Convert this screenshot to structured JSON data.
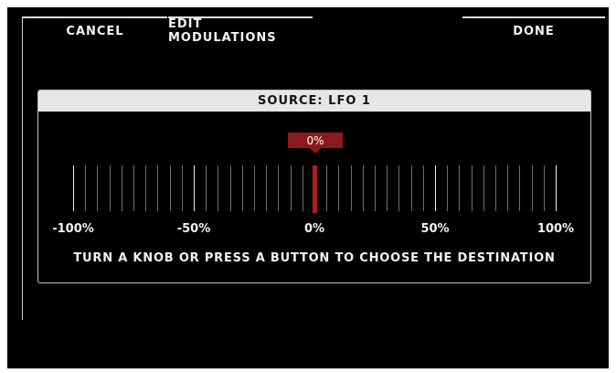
{
  "toolbar": {
    "cancel_label": "CANCEL",
    "title": "EDIT MODULATIONS",
    "done_label": "DONE"
  },
  "dialog": {
    "title": "SOURCE: LFO 1",
    "value_label": "0%",
    "value_percent": 0,
    "scale_labels": [
      "-100%",
      "-50%",
      "0%",
      "50%",
      "100%"
    ],
    "scale_range": [
      -100,
      100
    ],
    "instruction": "TURN A KNOB OR PRESS A BUTTON TO CHOOSE THE DESTINATION"
  },
  "colors": {
    "background": "#000000",
    "accent": "#8b1a1d",
    "indicator": "#b01e22",
    "header_bg": "#e6e6e6"
  }
}
